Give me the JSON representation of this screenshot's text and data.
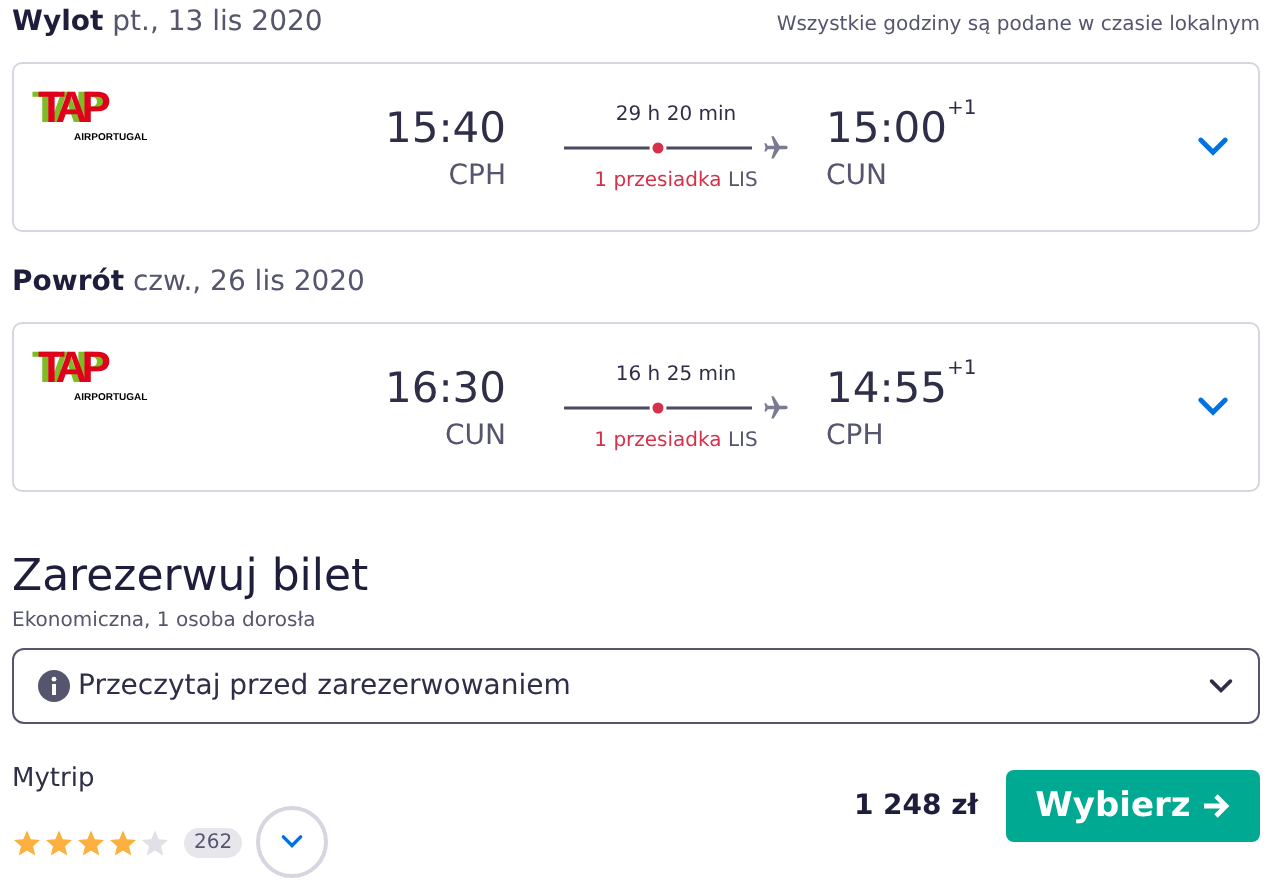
{
  "note": "Wszystkie godziny są podane w czasie lokalnym",
  "legs": [
    {
      "label": "Wylot",
      "date": "pt., 13 lis 2020",
      "logo": "TAP",
      "logo_caption": "AIRPORTUGAL",
      "dep_time": "15:40",
      "dep_airport": "CPH",
      "duration": "29 h 20 min",
      "stops": "1 przesiadka",
      "via": "LIS",
      "arr_time": "15:00",
      "arr_offset": "+1",
      "arr_airport": "CUN",
      "expanded": false
    },
    {
      "label": "Powrót",
      "date": "czw., 26 lis 2020",
      "logo": "TAP",
      "logo_caption": "AIRPORTUGAL",
      "dep_time": "16:30",
      "dep_airport": "CUN",
      "duration": "16 h 25 min",
      "stops": "1 przesiadka",
      "via": "LIS",
      "arr_time": "14:55",
      "arr_offset": "+1",
      "arr_airport": "CPH",
      "expanded": false
    }
  ],
  "booking": {
    "title": "Zarezerwuj bilet",
    "subtitle": "Ekonomiczna, 1 osoba dorosła",
    "info": "Przeczytaj przed zarezerwowaniem",
    "info_expanded": false,
    "provider": "Mytrip",
    "stars": 4,
    "reviews": "262",
    "price": "1 248 zł",
    "button": "Wybierz"
  }
}
